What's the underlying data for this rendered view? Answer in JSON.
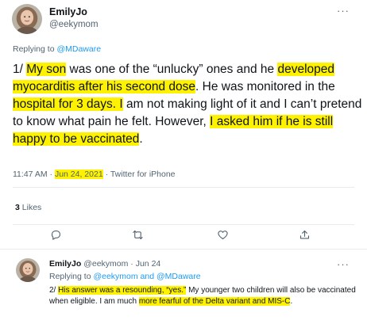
{
  "main_tweet": {
    "display_name": "EmilyJo",
    "handle": "@eekymom",
    "replying_prefix": "Replying to",
    "replying_mention": "@MDaware",
    "text_segments": [
      "1/ ",
      "My son",
      " was one of the “unlucky” ones and he ",
      "developed myocarditis after his second dose",
      ". He was monitored in the ",
      "hospital for 3 days. I",
      " am not making light of it and I can’t pretend to know what pain he felt. However, ",
      "I asked him if he is still happy to be vaccinated",
      "."
    ],
    "time": "11:47 AM",
    "separator": "·",
    "date": "Jun 24, 2021",
    "client": "Twitter for iPhone",
    "likes_count": "3",
    "likes_label": "Likes"
  },
  "reply_tweet": {
    "display_name": "EmilyJo",
    "handle": "@eekymom",
    "date": "Jun 24",
    "replying_prefix": "Replying to",
    "mention_1": "@eekymom",
    "and": "and",
    "mention_2": "@MDaware",
    "text_segments": [
      "2/ ",
      "His answer was a resounding, “yes.”",
      " My younger two children will also be vaccinated when eligible. I am much ",
      "more fearful of the Delta variant and MIS-C",
      "."
    ]
  },
  "icons": {
    "more": "more-horizontal-icon",
    "reply": "reply-icon",
    "retweet": "retweet-icon",
    "like": "heart-icon",
    "share": "share-icon"
  },
  "colors": {
    "highlight": "#fff200",
    "link": "#1d9bf0",
    "secondary_text": "#536471",
    "primary_text": "#0f1419"
  }
}
